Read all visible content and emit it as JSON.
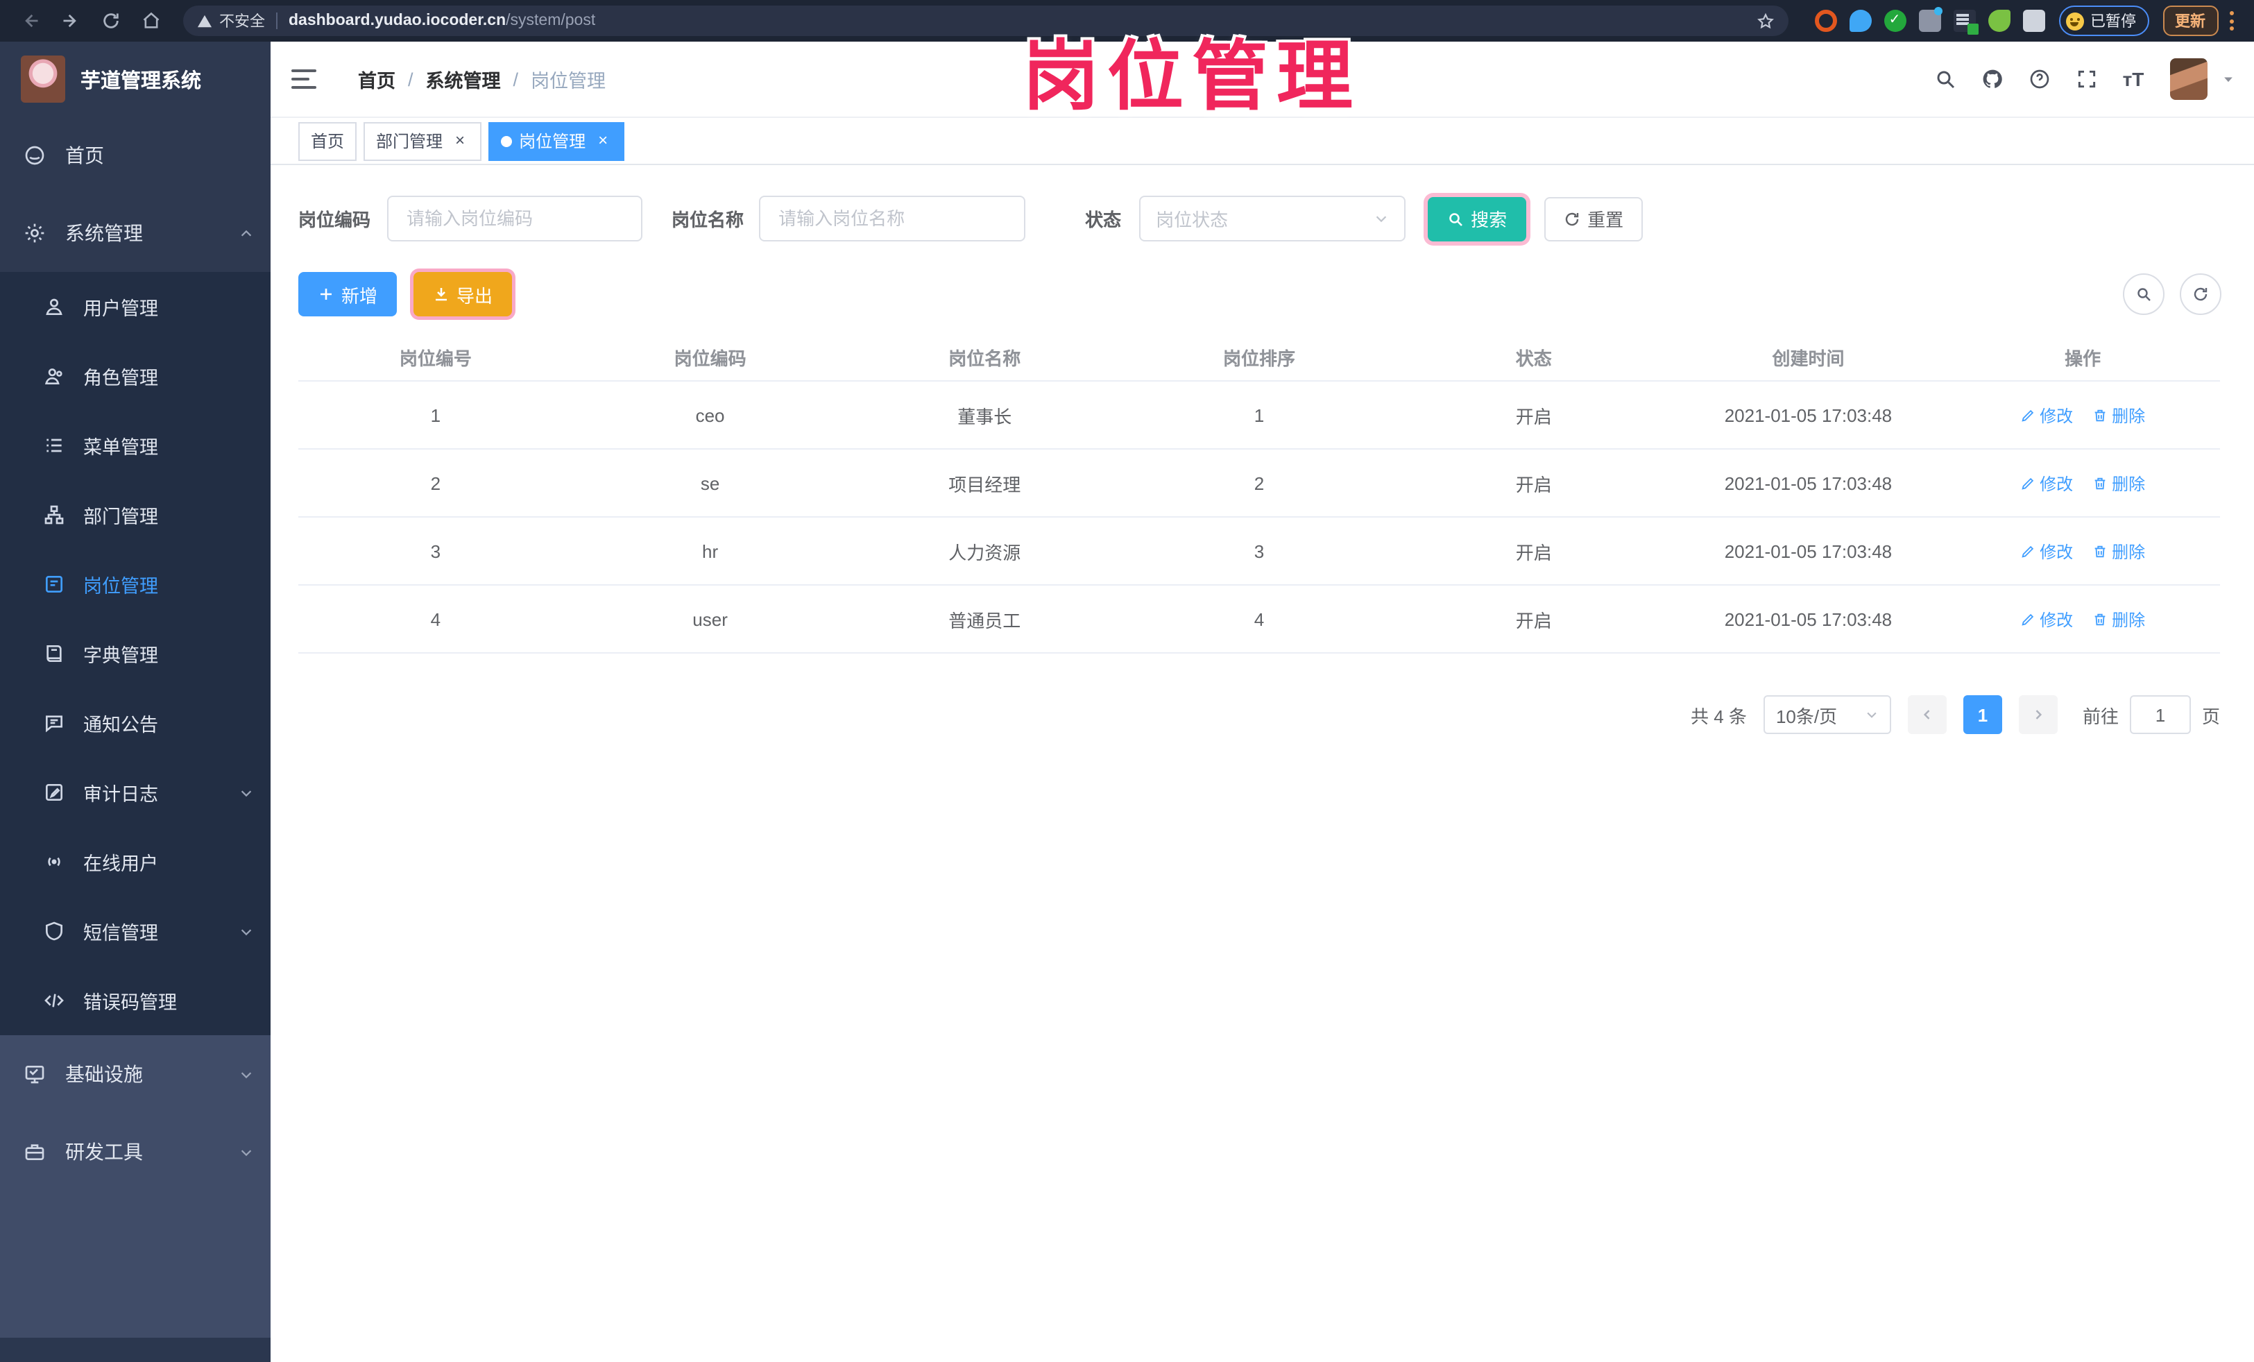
{
  "browser": {
    "security_label": "不安全",
    "url_host": "dashboard.yudao.iocoder.cn",
    "url_path": "/system/post",
    "paused_badge": "已暂停",
    "update_button": "更新"
  },
  "watermark": {
    "text": "岗位管理"
  },
  "sidebar": {
    "app_title": "芋道管理系统",
    "home_label": "首页",
    "system_label": "系统管理",
    "system_children": [
      {
        "label": "用户管理"
      },
      {
        "label": "角色管理"
      },
      {
        "label": "菜单管理"
      },
      {
        "label": "部门管理"
      },
      {
        "label": "岗位管理",
        "active": true
      },
      {
        "label": "字典管理"
      },
      {
        "label": "通知公告"
      },
      {
        "label": "审计日志",
        "arrow": "down"
      },
      {
        "label": "在线用户"
      },
      {
        "label": "短信管理",
        "arrow": "down"
      },
      {
        "label": "错误码管理"
      }
    ],
    "bottom_items": [
      {
        "label": "基础设施",
        "arrow": "down"
      },
      {
        "label": "研发工具",
        "arrow": "down"
      }
    ]
  },
  "navbar": {
    "breadcrumb": [
      "首页",
      "系统管理",
      "岗位管理"
    ],
    "separator": "/"
  },
  "tabs": {
    "close_glyph": "×",
    "items": [
      {
        "label": "首页"
      },
      {
        "label": "部门管理"
      },
      {
        "label": "岗位管理"
      }
    ]
  },
  "filters": {
    "code_label": "岗位编码",
    "code_placeholder": "请输入岗位编码",
    "name_label": "岗位名称",
    "name_placeholder": "请输入岗位名称",
    "status_label": "状态",
    "status_placeholder": "岗位状态",
    "search_label": "搜索",
    "reset_label": "重置"
  },
  "toolbar": {
    "add_label": "新增",
    "export_label": "导出"
  },
  "table": {
    "headers": [
      "岗位编号",
      "岗位编码",
      "岗位名称",
      "岗位排序",
      "状态",
      "创建时间",
      "操作"
    ],
    "edit_label": "修改",
    "delete_label": "删除",
    "rows": [
      {
        "id": "1",
        "code": "ceo",
        "name": "董事长",
        "sort": "1",
        "status": "开启",
        "time": "2021-01-05 17:03:48"
      },
      {
        "id": "2",
        "code": "se",
        "name": "项目经理",
        "sort": "2",
        "status": "开启",
        "time": "2021-01-05 17:03:48"
      },
      {
        "id": "3",
        "code": "hr",
        "name": "人力资源",
        "sort": "3",
        "status": "开启",
        "time": "2021-01-05 17:03:48"
      },
      {
        "id": "4",
        "code": "user",
        "name": "普通员工",
        "sort": "4",
        "status": "开启",
        "time": "2021-01-05 17:03:48"
      }
    ]
  },
  "pagination": {
    "total_text": "共 4 条",
    "page_size": "10条/页",
    "current_page": "1",
    "goto_label": "前往",
    "goto_value": "1",
    "unit_label": "页"
  },
  "colors": {
    "accent_blue": "#409eff",
    "search_teal": "#20beaa",
    "export_orange": "#f0a71c",
    "annotation_pink": "#f0265c",
    "sidebar_bg": "#2e3950",
    "submenu_bg": "#222e44"
  }
}
